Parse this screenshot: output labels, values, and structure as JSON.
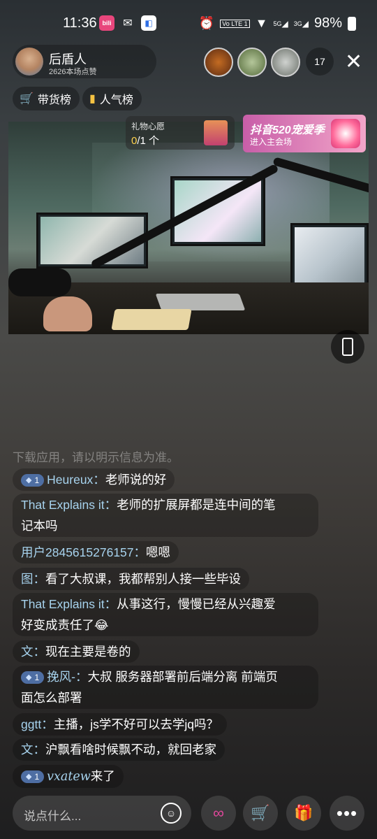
{
  "status_bar": {
    "time": "11:36",
    "app_badge_1": "bili",
    "battery": "98%",
    "net1": "5G",
    "net2": "3G",
    "volte": "Vo LTE 1"
  },
  "host": {
    "name": "后盾人",
    "likes": "2626本场点赞"
  },
  "viewers": {
    "count": "17"
  },
  "tags": {
    "goods_rank": "带货榜",
    "popularity_rank": "人气榜"
  },
  "gift_wish": {
    "title": "礼物心愿",
    "progress": "0",
    "total": "/1 个"
  },
  "promo": {
    "line1": "抖音520宠爱季",
    "line2": "进入主会场"
  },
  "chat": {
    "faded_text": "下载应用，请以明示信息为准。",
    "messages": [
      {
        "rank": "1",
        "user": "Heureux：",
        "text": "老师说的好"
      },
      {
        "user": "That Explains it：",
        "text": "老师的扩展屏都是连中间的笔",
        "text2": "记本吗"
      },
      {
        "user": "用户2845615276157：",
        "text": "嗯嗯"
      },
      {
        "user": "图：",
        "text": "看了大叔课，我都帮别人接一些毕设"
      },
      {
        "user": "That Explains it：",
        "text": "从事这行，慢慢已经从兴趣爱",
        "text2": "好变成责任了😂"
      },
      {
        "user": "文：",
        "text": "现在主要是卷的"
      },
      {
        "rank": "1",
        "user": "挽风-：",
        "text": "大叔 服务器部署前后端分离 前端页",
        "text2": "面怎么部署"
      },
      {
        "user": "ggtt：",
        "text": "主播，js学不好可以去学jq吗？"
      },
      {
        "user": "文：",
        "text": "沪飘看啥时候飘不动，就回老家"
      },
      {
        "rank": "1",
        "user": "vxatew",
        "text": "来了"
      }
    ]
  },
  "input": {
    "placeholder": "说点什么..."
  },
  "colors": {
    "username": "#a7d3ee",
    "rank_badge": "#4e6ea3",
    "accent_yellow": "#f5c242"
  }
}
